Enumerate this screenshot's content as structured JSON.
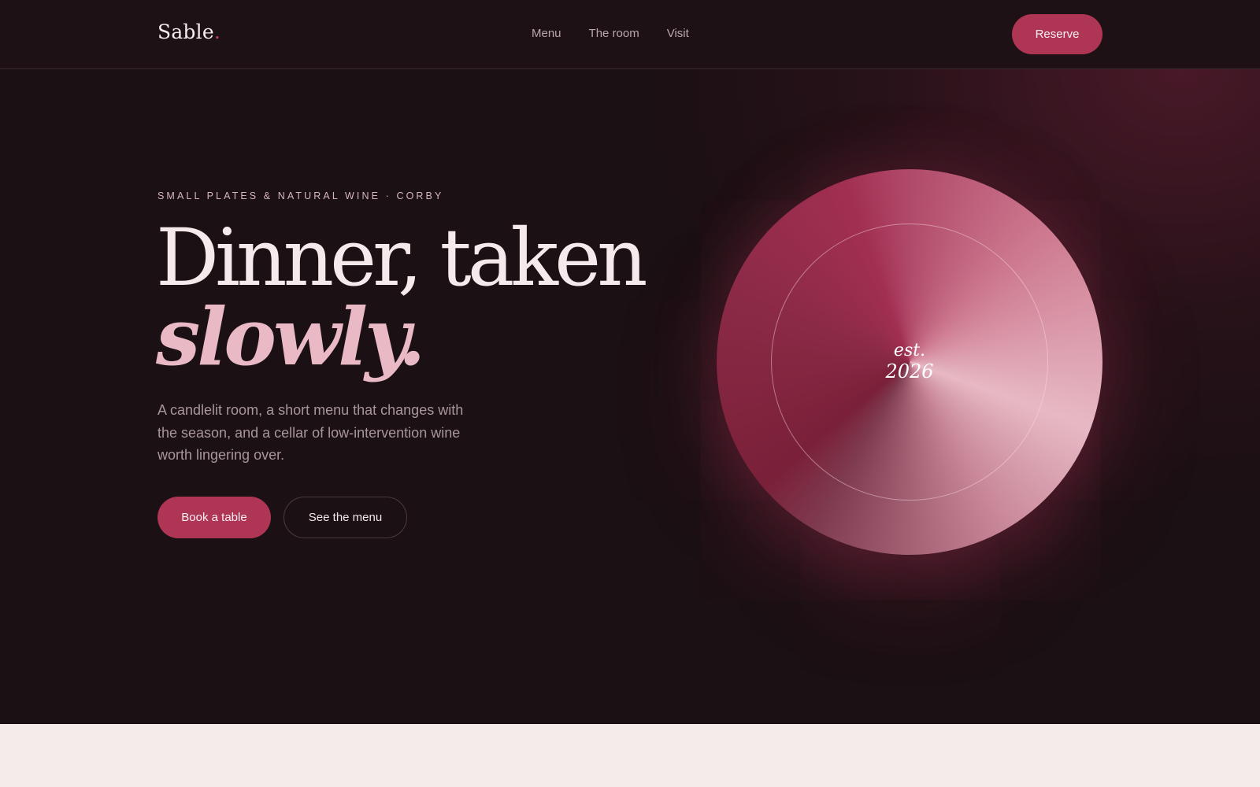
{
  "header": {
    "logo_text": "Sable",
    "logo_dot": ".",
    "nav": [
      {
        "label": "Menu"
      },
      {
        "label": "The room"
      },
      {
        "label": "Visit"
      }
    ],
    "reserve_label": "Reserve"
  },
  "hero": {
    "eyebrow": "SMALL PLATES & NATURAL WINE · CORBY",
    "headline_line1": "Dinner, taken",
    "headline_line2": "slowly.",
    "lede": "A candlelit room, a short menu that changes with the season, and a cellar of low-intervention wine worth lingering over.",
    "primary_cta": "Book a table",
    "secondary_cta": "See the menu",
    "badge": {
      "est_label": "est.",
      "year": "2026"
    }
  },
  "colors": {
    "accent": "#ae3654",
    "background": "#1b1014",
    "headline_italic": "#e9b9c5",
    "footer_band": "#f5ebea"
  }
}
